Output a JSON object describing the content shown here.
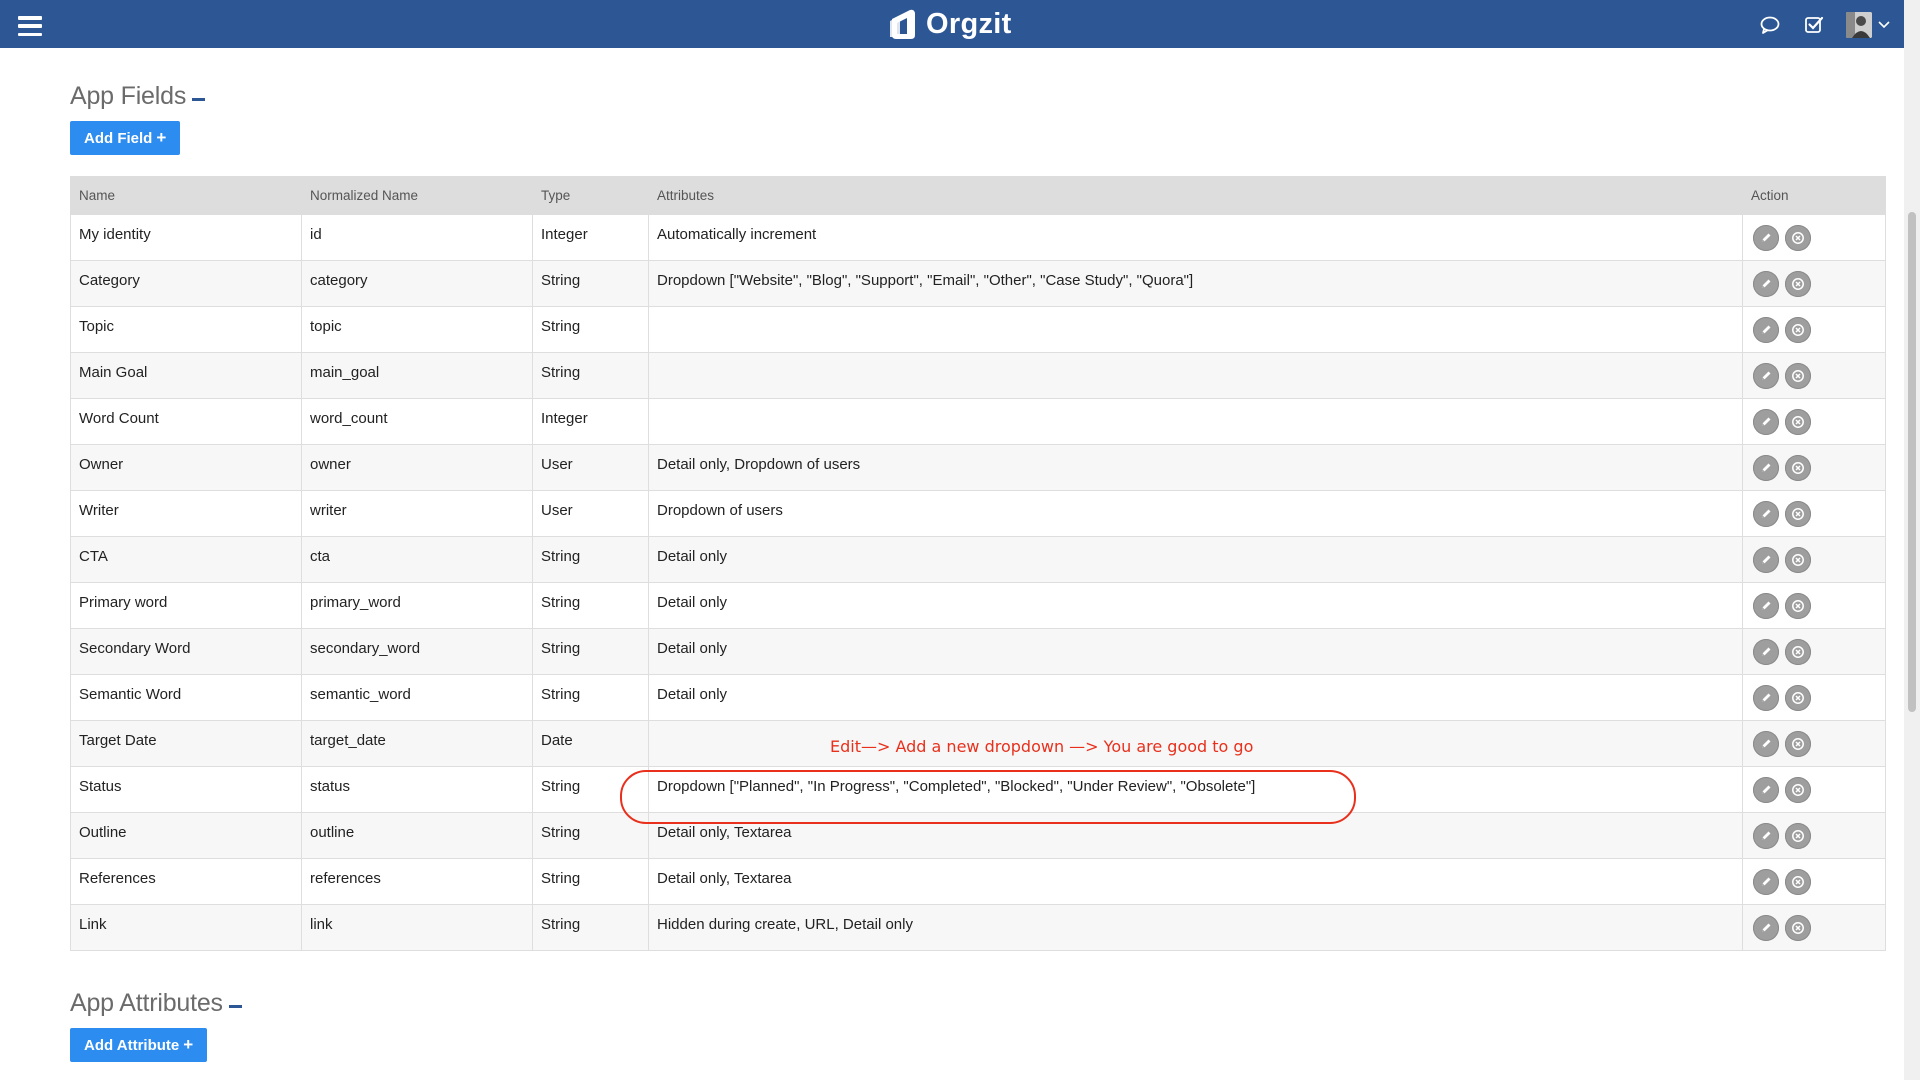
{
  "navbar": {
    "brand": "Orgzit",
    "menu_icon": "hamburger-menu-icon",
    "icons": [
      "chat-bubble-icon",
      "checkbox-check-icon",
      "user-avatar-icon",
      "chevron-down-icon"
    ],
    "color": "#2c5694"
  },
  "fields_section": {
    "title": "App Fields",
    "add_button_label": "Add Field",
    "columns": [
      "Name",
      "Normalized Name",
      "Type",
      "Attributes",
      "Action"
    ],
    "rows": [
      {
        "name": "My identity",
        "normalized": "id",
        "type": "Integer",
        "attributes": "Automatically increment"
      },
      {
        "name": "Category",
        "normalized": "category",
        "type": "String",
        "attributes": "Dropdown [\"Website\", \"Blog\", \"Support\", \"Email\", \"Other\", \"Case Study\", \"Quora\"]"
      },
      {
        "name": "Topic",
        "normalized": "topic",
        "type": "String",
        "attributes": ""
      },
      {
        "name": "Main Goal",
        "normalized": "main_goal",
        "type": "String",
        "attributes": ""
      },
      {
        "name": "Word Count",
        "normalized": "word_count",
        "type": "Integer",
        "attributes": ""
      },
      {
        "name": "Owner",
        "normalized": "owner",
        "type": "User",
        "attributes": "Detail only, Dropdown of users"
      },
      {
        "name": "Writer",
        "normalized": "writer",
        "type": "User",
        "attributes": "Dropdown of users"
      },
      {
        "name": "CTA",
        "normalized": "cta",
        "type": "String",
        "attributes": "Detail only"
      },
      {
        "name": "Primary word",
        "normalized": "primary_word",
        "type": "String",
        "attributes": "Detail only"
      },
      {
        "name": "Secondary Word",
        "normalized": "secondary_word",
        "type": "String",
        "attributes": "Detail only"
      },
      {
        "name": "Semantic Word",
        "normalized": "semantic_word",
        "type": "String",
        "attributes": "Detail only"
      },
      {
        "name": "Target Date",
        "normalized": "target_date",
        "type": "Date",
        "attributes": ""
      },
      {
        "name": "Status",
        "normalized": "status",
        "type": "String",
        "attributes": "Dropdown [\"Planned\", \"In Progress\", \"Completed\", \"Blocked\", \"Under Review\", \"Obsolete\"]"
      },
      {
        "name": "Outline",
        "normalized": "outline",
        "type": "String",
        "attributes": "Detail only, Textarea"
      },
      {
        "name": "References",
        "normalized": "references",
        "type": "String",
        "attributes": "Detail only, Textarea"
      },
      {
        "name": "Link",
        "normalized": "link",
        "type": "String",
        "attributes": "Hidden during create, URL, Detail only"
      }
    ],
    "row_action_icons": [
      "edit-pencil-icon",
      "delete-x-icon"
    ]
  },
  "annotation": {
    "text": "Edit—> Add a new dropdown —> You are good to go",
    "color": "#e8301c"
  },
  "attributes_section": {
    "title": "App Attributes",
    "add_button_label": "Add Attribute"
  }
}
